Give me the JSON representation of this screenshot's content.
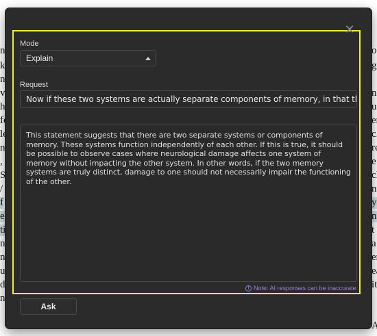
{
  "dialog": {
    "close_icon": "close-icon",
    "mode_label": "Mode",
    "mode_value": "Explain",
    "request_label": "Request",
    "request_value": "Now if these two systems are actually separate components of memory, in that they functio",
    "response_text": "This statement suggests that there are two separate systems or components of memory. These systems function independently of each other. If this is true, it should be possible to observe cases where neurological damage affects one system of memory without impacting the other system. In other words, if the two memory systems are truly distinct, damage to one should not necessarily impair the functioning of the other.",
    "note": "Note: AI responses can be inaccurate",
    "ask_label": "Ask"
  },
  "colors": {
    "dialog_bg": "#2b2b2b",
    "focus_frame": "#f3ef3a",
    "note": "#9a7bd6",
    "highlight": "#cfe0e6"
  },
  "background_doc": {
    "left_fragments": [
      "nt",
      "ka",
      "n",
      "vi",
      "h",
      "fe",
      "le",
      "n",
      ",",
      "S",
      "/",
      "f",
      "e",
      "ti",
      "n",
      "n",
      "u",
      "d",
      "n"
    ],
    "right_fragments": [
      "o",
      "g",
      "ns",
      "uc",
      "er",
      "c.",
      "re",
      "e",
      "cl",
      "nt",
      "y",
      "n",
      "t",
      "a",
      "er",
      "ea",
      "it",
      "A"
    ]
  }
}
